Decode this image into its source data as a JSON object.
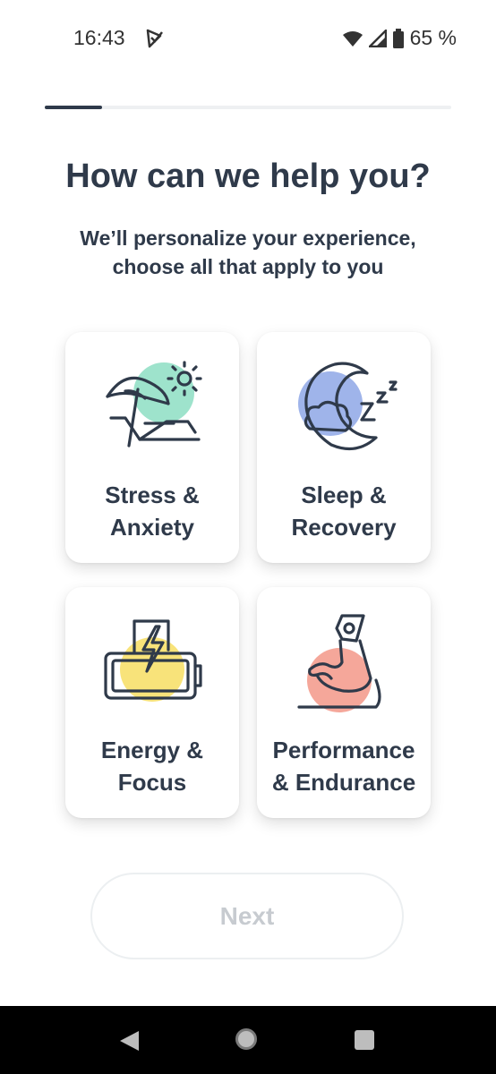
{
  "status_bar": {
    "time": "16:43",
    "battery": "65 %"
  },
  "onboarding": {
    "progress": 0.14
  },
  "header": {
    "title": "How can we help you?",
    "subtitle_line1": "We’ll personalize your experience,",
    "subtitle_line2": "choose all that apply to you"
  },
  "options": [
    {
      "line1": "Stress &",
      "line2": "Anxiety",
      "icon": "beach-chair-icon",
      "accent": "#9ee3cc"
    },
    {
      "line1": "Sleep &",
      "line2": "Recovery",
      "icon": "moon-cloud-icon",
      "accent": "#9fb4ea"
    },
    {
      "line1": "Energy &",
      "line2": "Focus",
      "icon": "battery-bolt-icon",
      "accent": "#f8e37a"
    },
    {
      "line1": "Performance",
      "line2": "& Endurance",
      "icon": "flexed-arm-icon",
      "accent": "#f5a79a"
    }
  ],
  "next_label": "Next"
}
